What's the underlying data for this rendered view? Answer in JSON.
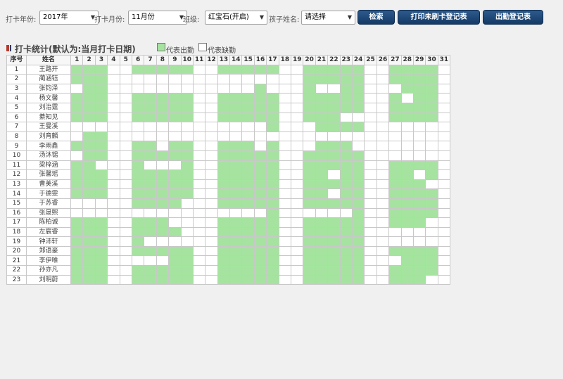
{
  "filters": {
    "year_label": "打卡年份:",
    "year_value": "2017年",
    "month_label": "打卡月份:",
    "month_value": "11月份",
    "class_label": "班级:",
    "class_value": "红宝石(开启)",
    "child_label": "孩子姓名:",
    "child_value": "请选择"
  },
  "buttons": {
    "search": "检索",
    "print_unswiped": "打印未刷卡登记表",
    "attendance_register": "出勤登记表"
  },
  "section": {
    "title": "打卡统计(默认为:当月打卡日期)",
    "legend_present": "代表出勤",
    "legend_absent": "代表缺勤"
  },
  "colors": {
    "present": "#a6e3a1",
    "absent": "#ffffff"
  },
  "table": {
    "headers": {
      "index": "序号",
      "name": "姓名"
    },
    "days": [
      1,
      2,
      3,
      4,
      5,
      6,
      7,
      8,
      9,
      10,
      11,
      12,
      13,
      14,
      15,
      16,
      17,
      18,
      19,
      20,
      21,
      22,
      23,
      24,
      25,
      26,
      27,
      28,
      29,
      30,
      31
    ],
    "rows": [
      {
        "index": 1,
        "name": "王路开",
        "present": [
          1,
          2,
          3,
          6,
          7,
          8,
          9,
          10,
          13,
          14,
          15,
          16,
          17,
          20,
          21,
          22,
          23,
          24,
          27,
          28,
          29,
          30
        ]
      },
      {
        "index": 2,
        "name": "蔺涵钰",
        "present": [
          1,
          2,
          3,
          20,
          21,
          22,
          23,
          24,
          27,
          28,
          29,
          30
        ]
      },
      {
        "index": 3,
        "name": "张钧泽",
        "present": [
          2,
          3,
          16,
          20,
          23,
          24,
          28,
          29,
          30
        ]
      },
      {
        "index": 4,
        "name": "杨文馨",
        "present": [
          1,
          2,
          3,
          6,
          7,
          8,
          9,
          10,
          13,
          14,
          15,
          16,
          17,
          20,
          21,
          22,
          23,
          24,
          27,
          29,
          30
        ]
      },
      {
        "index": 5,
        "name": "刘治霆",
        "present": [
          1,
          2,
          3,
          6,
          7,
          8,
          9,
          10,
          13,
          14,
          15,
          16,
          17,
          20,
          21,
          22,
          23,
          24,
          27,
          28,
          29,
          30
        ]
      },
      {
        "index": 6,
        "name": "綦知见",
        "present": [
          1,
          2,
          3,
          6,
          7,
          8,
          9,
          10,
          13,
          14,
          15,
          16,
          17,
          20,
          21,
          22,
          27,
          28,
          29,
          30
        ]
      },
      {
        "index": 7,
        "name": "王曼溪",
        "present": [
          17,
          21,
          22,
          23,
          24
        ]
      },
      {
        "index": 8,
        "name": "刘育麟",
        "present": [
          2,
          3
        ]
      },
      {
        "index": 9,
        "name": "李雨鑫",
        "present": [
          1,
          2,
          3,
          6,
          7,
          9,
          10,
          13,
          14,
          15,
          17,
          21,
          22,
          23
        ]
      },
      {
        "index": 10,
        "name": "汤沐锡",
        "present": [
          2,
          3,
          6,
          7,
          8,
          9,
          10,
          13,
          14,
          15,
          16,
          17,
          20,
          21,
          22,
          23,
          24
        ]
      },
      {
        "index": 11,
        "name": "梁梓涵",
        "present": [
          1,
          2,
          6,
          10,
          13,
          14,
          15,
          16,
          17,
          20,
          21,
          22,
          23,
          24,
          27,
          28,
          29,
          30
        ]
      },
      {
        "index": 12,
        "name": "张馨瑶",
        "present": [
          1,
          2,
          3,
          6,
          7,
          8,
          9,
          10,
          13,
          14,
          15,
          16,
          17,
          20,
          21,
          23,
          24,
          27,
          28,
          30
        ]
      },
      {
        "index": 13,
        "name": "曹美溪",
        "present": [
          1,
          2,
          3,
          6,
          7,
          8,
          9,
          10,
          13,
          14,
          15,
          16,
          17,
          20,
          21,
          22,
          23,
          24,
          27,
          28,
          29
        ]
      },
      {
        "index": 14,
        "name": "于德雯",
        "present": [
          1,
          2,
          3,
          6,
          7,
          8,
          9,
          10,
          13,
          14,
          15,
          16,
          17,
          20,
          21,
          23,
          24,
          27,
          28,
          29,
          30
        ]
      },
      {
        "index": 15,
        "name": "于苏睿",
        "present": [
          6,
          7,
          8,
          9,
          13,
          14,
          15,
          16,
          17,
          20,
          21,
          22,
          23,
          24,
          27,
          28,
          29,
          30
        ]
      },
      {
        "index": 16,
        "name": "张晟熙",
        "present": [
          17,
          24,
          27,
          28,
          29,
          30
        ]
      },
      {
        "index": 17,
        "name": "陈柏诚",
        "present": [
          1,
          2,
          3,
          6,
          7,
          8,
          13,
          14,
          15,
          16,
          17,
          20,
          21,
          22,
          23,
          24,
          27,
          28,
          29
        ]
      },
      {
        "index": 18,
        "name": "左宸睿",
        "present": [
          1,
          2,
          3,
          6,
          7,
          8,
          9,
          13,
          14,
          15,
          16,
          17,
          20,
          21,
          22,
          23,
          24
        ]
      },
      {
        "index": 19,
        "name": "钟沛轩",
        "present": [
          1,
          2,
          3,
          6,
          13,
          14,
          15,
          16,
          17,
          20,
          21,
          22,
          23,
          24
        ]
      },
      {
        "index": 20,
        "name": "郑语豪",
        "present": [
          1,
          2,
          3,
          6,
          7,
          8,
          9,
          10,
          13,
          14,
          15,
          16,
          17,
          20,
          21,
          22,
          23,
          24,
          27,
          28,
          29,
          30
        ]
      },
      {
        "index": 21,
        "name": "李伊唯",
        "present": [
          1,
          2,
          3,
          9,
          10,
          13,
          14,
          15,
          16,
          17,
          20,
          21,
          22,
          23,
          24,
          28,
          29,
          30
        ]
      },
      {
        "index": 22,
        "name": "孙亦凡",
        "present": [
          1,
          2,
          3,
          6,
          7,
          8,
          9,
          10,
          13,
          14,
          15,
          16,
          17,
          20,
          21,
          22,
          23,
          24,
          27,
          28,
          29,
          30
        ]
      },
      {
        "index": 23,
        "name": "刘明蔚",
        "present": [
          1,
          2,
          3,
          6,
          7,
          8,
          9,
          10,
          13,
          14,
          15,
          16,
          17,
          20,
          21,
          22,
          23,
          24,
          27,
          28,
          29
        ]
      }
    ]
  }
}
